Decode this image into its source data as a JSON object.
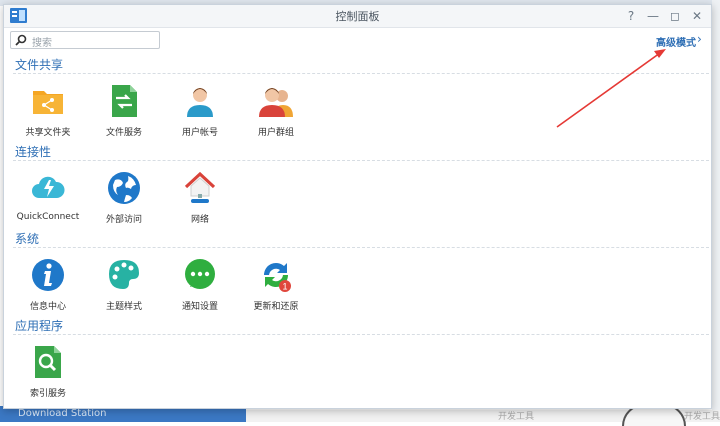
{
  "window": {
    "title": "控制面板"
  },
  "window_buttons": {
    "help": "?",
    "minimize": "—",
    "maximize": "◻",
    "close": "✕"
  },
  "search": {
    "placeholder": "搜索"
  },
  "advanced_mode": {
    "label": "高级模式",
    "chevron": "›"
  },
  "sections": [
    {
      "title": "文件共享",
      "items": [
        {
          "label": "共享文件夹",
          "icon": "shared-folder-icon"
        },
        {
          "label": "文件服务",
          "icon": "file-services-icon"
        },
        {
          "label": "用户帐号",
          "icon": "user-icon"
        },
        {
          "label": "用户群组",
          "icon": "group-icon"
        }
      ]
    },
    {
      "title": "连接性",
      "items": [
        {
          "label": "QuickConnect",
          "icon": "quickconnect-icon"
        },
        {
          "label": "外部访问",
          "icon": "external-access-icon"
        },
        {
          "label": "网络",
          "icon": "network-icon"
        }
      ]
    },
    {
      "title": "系统",
      "items": [
        {
          "label": "信息中心",
          "icon": "info-center-icon"
        },
        {
          "label": "主题样式",
          "icon": "theme-icon"
        },
        {
          "label": "通知设置",
          "icon": "notification-icon"
        },
        {
          "label": "更新和还原",
          "icon": "update-restore-icon",
          "badge": "1"
        }
      ]
    },
    {
      "title": "应用程序",
      "items": [
        {
          "label": "索引服务",
          "icon": "indexing-service-icon"
        }
      ]
    }
  ],
  "background": {
    "taskbar_label": "Download Station",
    "text_a": "开发工具",
    "text_b": "开发工具"
  },
  "colors": {
    "accent": "#2f6fb5",
    "arrow": "#e53935"
  }
}
